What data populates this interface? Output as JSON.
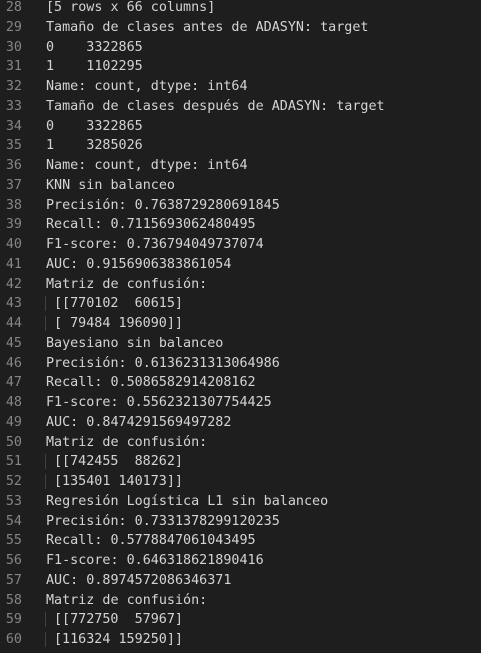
{
  "editor": {
    "lines": [
      {
        "n": "28",
        "text": "[5 rows x 66 columns]",
        "indent": false
      },
      {
        "n": "29",
        "text": "Tamaño de clases antes de ADASYN: target",
        "indent": false
      },
      {
        "n": "30",
        "text": "0    3322865",
        "indent": false
      },
      {
        "n": "31",
        "text": "1    1102295",
        "indent": false
      },
      {
        "n": "32",
        "text": "Name: count, dtype: int64",
        "indent": false
      },
      {
        "n": "33",
        "text": "Tamaño de clases después de ADASYN: target",
        "indent": false
      },
      {
        "n": "34",
        "text": "0    3322865",
        "indent": false
      },
      {
        "n": "35",
        "text": "1    3285026",
        "indent": false
      },
      {
        "n": "36",
        "text": "Name: count, dtype: int64",
        "indent": false
      },
      {
        "n": "37",
        "text": "KNN sin balanceo",
        "indent": false
      },
      {
        "n": "38",
        "text": "Precisión: 0.7638729280691845",
        "indent": false
      },
      {
        "n": "39",
        "text": "Recall: 0.7115693062480495",
        "indent": false
      },
      {
        "n": "40",
        "text": "F1-score: 0.736794049737074",
        "indent": false
      },
      {
        "n": "41",
        "text": "AUC: 0.9156906383861054",
        "indent": false
      },
      {
        "n": "42",
        "text": "Matriz de confusión:",
        "indent": false
      },
      {
        "n": "43",
        "text": "[[770102  60615]",
        "indent": true
      },
      {
        "n": "44",
        "text": "[ 79484 196090]]",
        "indent": true
      },
      {
        "n": "45",
        "text": "Bayesiano sin balanceo",
        "indent": false
      },
      {
        "n": "46",
        "text": "Precisión: 0.6136231313064986",
        "indent": false
      },
      {
        "n": "47",
        "text": "Recall: 0.5086582914208162",
        "indent": false
      },
      {
        "n": "48",
        "text": "F1-score: 0.5562321307754425",
        "indent": false
      },
      {
        "n": "49",
        "text": "AUC: 0.8474291569497282",
        "indent": false
      },
      {
        "n": "50",
        "text": "Matriz de confusión:",
        "indent": false
      },
      {
        "n": "51",
        "text": "[[742455  88262]",
        "indent": true
      },
      {
        "n": "52",
        "text": "[135401 140173]]",
        "indent": true
      },
      {
        "n": "53",
        "text": "Regresión Logística L1 sin balanceo",
        "indent": false
      },
      {
        "n": "54",
        "text": "Precisión: 0.7331378299120235",
        "indent": false
      },
      {
        "n": "55",
        "text": "Recall: 0.5778847061043495",
        "indent": false
      },
      {
        "n": "56",
        "text": "F1-score: 0.646318621890416",
        "indent": false
      },
      {
        "n": "57",
        "text": "AUC: 0.8974572086346371",
        "indent": false
      },
      {
        "n": "58",
        "text": "Matriz de confusión:",
        "indent": false
      },
      {
        "n": "59",
        "text": "[[772750  57967]",
        "indent": true
      },
      {
        "n": "60",
        "text": "[116324 159250]]",
        "indent": true
      }
    ]
  }
}
